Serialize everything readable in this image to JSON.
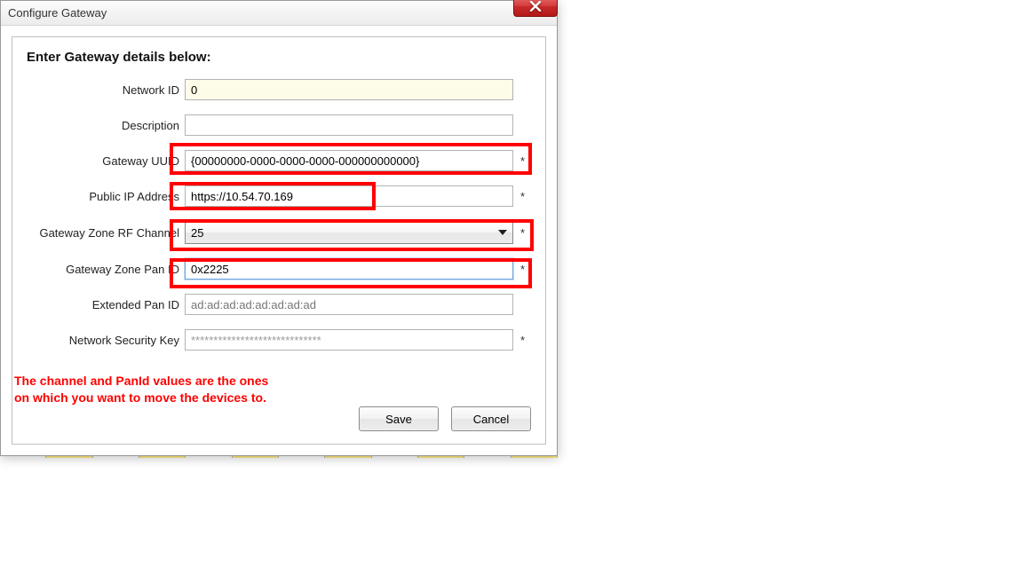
{
  "window": {
    "title": "Configure Gateway"
  },
  "heading": "Enter Gateway details below:",
  "fields": {
    "network_id": {
      "label": "Network ID",
      "value": "0"
    },
    "description": {
      "label": "Description",
      "value": ""
    },
    "gateway_uuid": {
      "label": "Gateway UUID",
      "value": "{00000000-0000-0000-0000-000000000000}",
      "asterisk": "*"
    },
    "public_ip": {
      "label": "Public IP Address",
      "value": "https://10.54.70.169",
      "asterisk": "*"
    },
    "rf_channel": {
      "label": "Gateway Zone RF Channel",
      "value": "25",
      "asterisk": "*"
    },
    "pan_id": {
      "label": "Gateway Zone Pan ID",
      "value": "0x2225",
      "asterisk": "*"
    },
    "ext_pan_id": {
      "label": "Extended Pan ID",
      "placeholder": "ad:ad:ad:ad:ad:ad:ad:ad"
    },
    "sec_key": {
      "label": "Network Security Key",
      "value": "*****************************",
      "asterisk": "*"
    }
  },
  "buttons": {
    "save": "Save",
    "cancel": "Cancel"
  },
  "annotation": "The channel and PanId values are the ones on which you want to move the devices to."
}
